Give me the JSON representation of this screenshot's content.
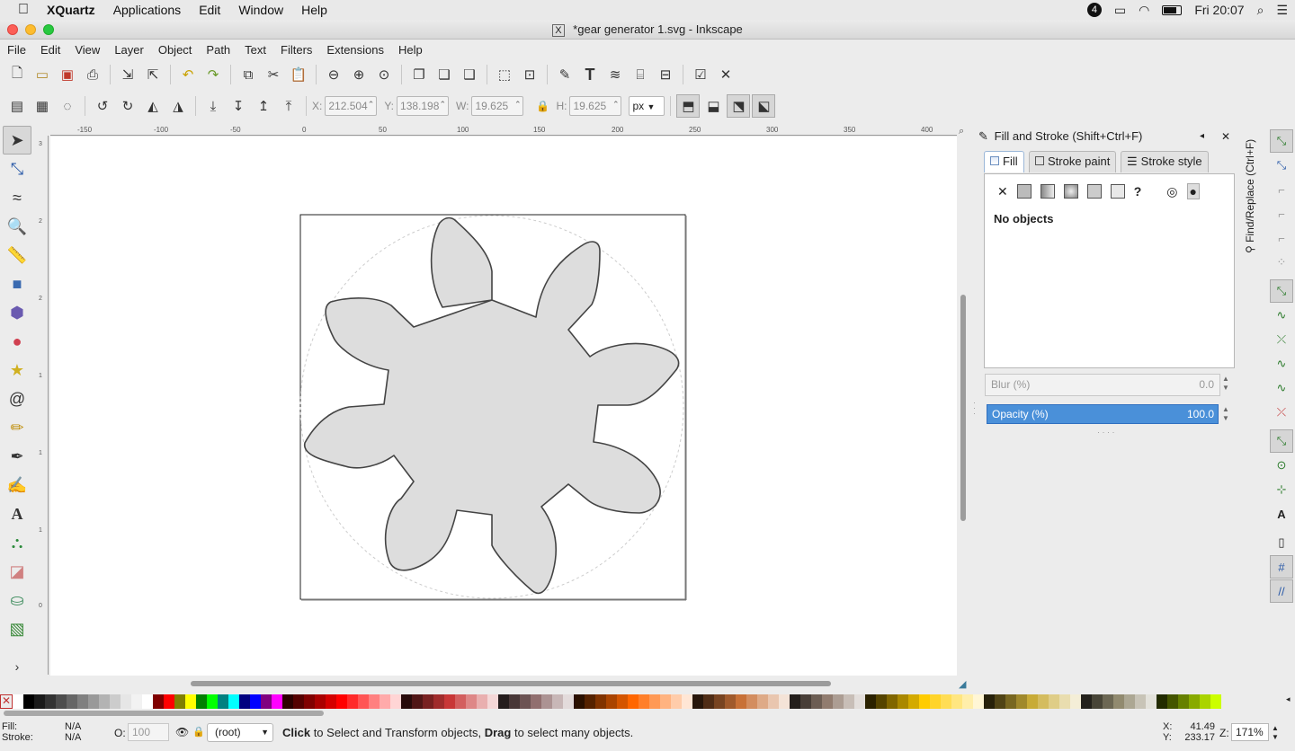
{
  "macmenu": {
    "app": "XQuartz",
    "items": [
      "Applications",
      "Edit",
      "Window",
      "Help"
    ],
    "clock": "Fri 20:07",
    "badge": "4"
  },
  "window": {
    "title": "*gear generator 1.svg - Inkscape"
  },
  "menu": [
    "File",
    "Edit",
    "View",
    "Layer",
    "Object",
    "Path",
    "Text",
    "Filters",
    "Extensions",
    "Help"
  ],
  "toolbar2": {
    "x_label": "X:",
    "x_value": "212.504",
    "y_label": "Y:",
    "y_value": "138.198",
    "w_label": "W:",
    "w_value": "19.625",
    "h_label": "H:",
    "h_value": "19.625",
    "unit": "px"
  },
  "ruler_top": [
    "-150",
    "-100",
    "-50",
    "0",
    "50",
    "100",
    "150",
    "200",
    "250",
    "300",
    "350",
    "400"
  ],
  "ruler_left": [
    "3",
    "2",
    "2",
    "1",
    "1",
    "5",
    "1",
    "0",
    "0",
    "5",
    "0"
  ],
  "dialog": {
    "title": "Fill and Stroke (Shift+Ctrl+F)",
    "tabs": [
      "Fill",
      "Stroke paint",
      "Stroke style"
    ],
    "message": "No objects",
    "blur_label": "Blur (%)",
    "blur_value": "0.0",
    "opacity_label": "Opacity (%)",
    "opacity_value": "100.0",
    "side_tab": "Find/Replace (Ctrl+F)"
  },
  "status": {
    "fill_label": "Fill:",
    "fill_value": "N/A",
    "stroke_label": "Stroke:",
    "stroke_value": "N/A",
    "opacity_label": "O:",
    "opacity_value": "100",
    "layer": "(root)",
    "message_b1": "Click",
    "message_t1": " to Select and Transform objects, ",
    "message_b2": "Drag",
    "message_t2": " to select many objects.",
    "x_label": "X:",
    "x_value": "41.49",
    "y_label": "Y:",
    "y_value": "233.17",
    "zoom_label": "Z:",
    "zoom_value": "171%"
  },
  "palette": [
    "#ffffff",
    "#000000",
    "#1a1a1a",
    "#333333",
    "#4d4d4d",
    "#666666",
    "#808080",
    "#999999",
    "#b3b3b3",
    "#cccccc",
    "#e6e6e6",
    "#f2f2f2",
    "#ffffff",
    "#800000",
    "#ff0000",
    "#808000",
    "#ffff00",
    "#008000",
    "#00ff00",
    "#008080",
    "#00ffff",
    "#000080",
    "#0000ff",
    "#800080",
    "#ff00ff",
    "#2b0000",
    "#550000",
    "#800000",
    "#aa0000",
    "#d40000",
    "#ff0000",
    "#ff2a2a",
    "#ff5555",
    "#ff8080",
    "#ffaaaa",
    "#ffd5d5",
    "#280b0b",
    "#501616",
    "#782121",
    "#a02c2c",
    "#c83737",
    "#d35f5f",
    "#de8787",
    "#e9afaf",
    "#f4d7d7",
    "#241c1c",
    "#483737",
    "#6c5353",
    "#916f6f",
    "#ac9393",
    "#c8b7b7",
    "#e3dbdb",
    "#2b1100",
    "#552200",
    "#803300",
    "#aa4400",
    "#d45500",
    "#ff6600",
    "#ff7f2a",
    "#ff9955",
    "#ffb380",
    "#ffccaa",
    "#ffe6d5",
    "#28170b",
    "#502d16",
    "#784421",
    "#a05a2c",
    "#c87137",
    "#d38d5f",
    "#deaa87",
    "#e9c6af",
    "#f4e3d7",
    "#241f1c",
    "#483e37",
    "#6c5d53",
    "#917c6f",
    "#ac9d93",
    "#c8beb7",
    "#e3dedb",
    "#2b2200",
    "#554400",
    "#806600",
    "#aa8800",
    "#d4aa00",
    "#ffcc00",
    "#ffd42a",
    "#ffdd55",
    "#ffe680",
    "#ffeeaa",
    "#fff6d5",
    "#28220b",
    "#504416",
    "#786721",
    "#a0892c",
    "#c8ab37",
    "#d4bc5f",
    "#dfcd87",
    "#e9ddaf",
    "#f4eed7",
    "#24221c",
    "#484537",
    "#6c6753",
    "#918a6f",
    "#aca793",
    "#c8c4b7",
    "#e3e2db",
    "#222b00",
    "#445500",
    "#668000",
    "#88aa00",
    "#aad400",
    "#ccff00"
  ]
}
